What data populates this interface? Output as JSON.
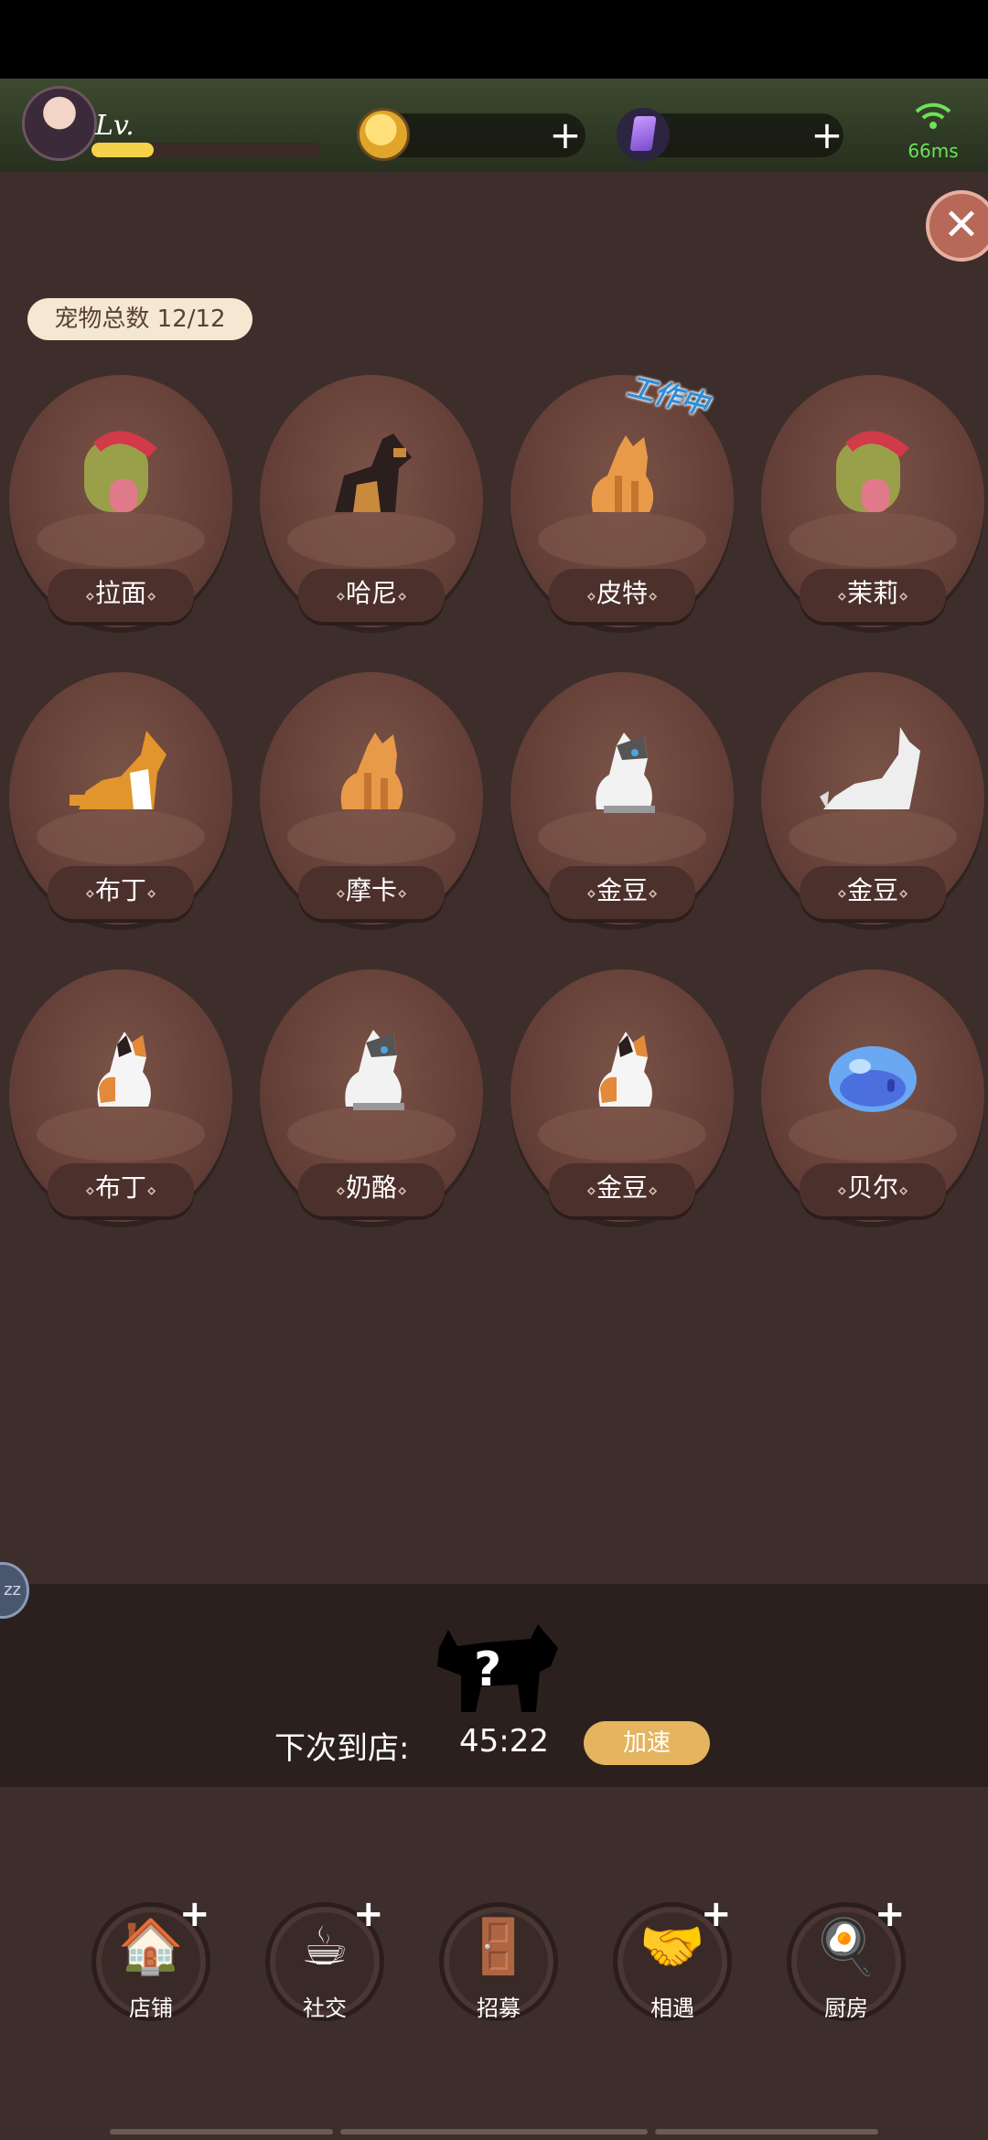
{
  "hud": {
    "level_label": "Lv.",
    "xp_fraction": 0.27,
    "ping": "66ms",
    "coin_icon": "cat-coin-icon",
    "gem_icon": "purple-gem-icon",
    "plus": "+",
    "wifi_icon": "wifi-icon"
  },
  "close_label": "✕",
  "pet_count": "宠物总数 12/12",
  "working_tag": "工作中",
  "deco": "⋄",
  "pets": [
    {
      "name": "拉面",
      "kind": "helmet"
    },
    {
      "name": "哈尼",
      "kind": "shepherd"
    },
    {
      "name": "皮特",
      "kind": "orange-cat"
    },
    {
      "name": "茉莉",
      "kind": "helmet"
    },
    {
      "name": "布丁",
      "kind": "corgi"
    },
    {
      "name": "摩卡",
      "kind": "orange-cat"
    },
    {
      "name": "金豆",
      "kind": "white-cat"
    },
    {
      "name": "金豆",
      "kind": "white-dog"
    },
    {
      "name": "布丁",
      "kind": "calico"
    },
    {
      "name": "奶酪",
      "kind": "white-cat"
    },
    {
      "name": "金豆",
      "kind": "calico"
    },
    {
      "name": "贝尔",
      "kind": "slime"
    }
  ],
  "arrival": {
    "label": "下次到店:",
    "time": "45:22",
    "speed_label": "加速",
    "mystery": "?"
  },
  "side_tab": "zz",
  "nav": [
    {
      "label": "店铺",
      "icon": "shop-icon",
      "glyph": "🏠",
      "has_plus": true
    },
    {
      "label": "社交",
      "icon": "coffee-cup-icon",
      "glyph": "☕",
      "has_plus": true
    },
    {
      "label": "招募",
      "icon": "door-icon",
      "glyph": "🚪",
      "has_plus": false
    },
    {
      "label": "相遇",
      "icon": "handshake-icon",
      "glyph": "🤝",
      "has_plus": true
    },
    {
      "label": "厨房",
      "icon": "frying-pan-icon",
      "glyph": "🍳",
      "has_plus": true
    }
  ]
}
